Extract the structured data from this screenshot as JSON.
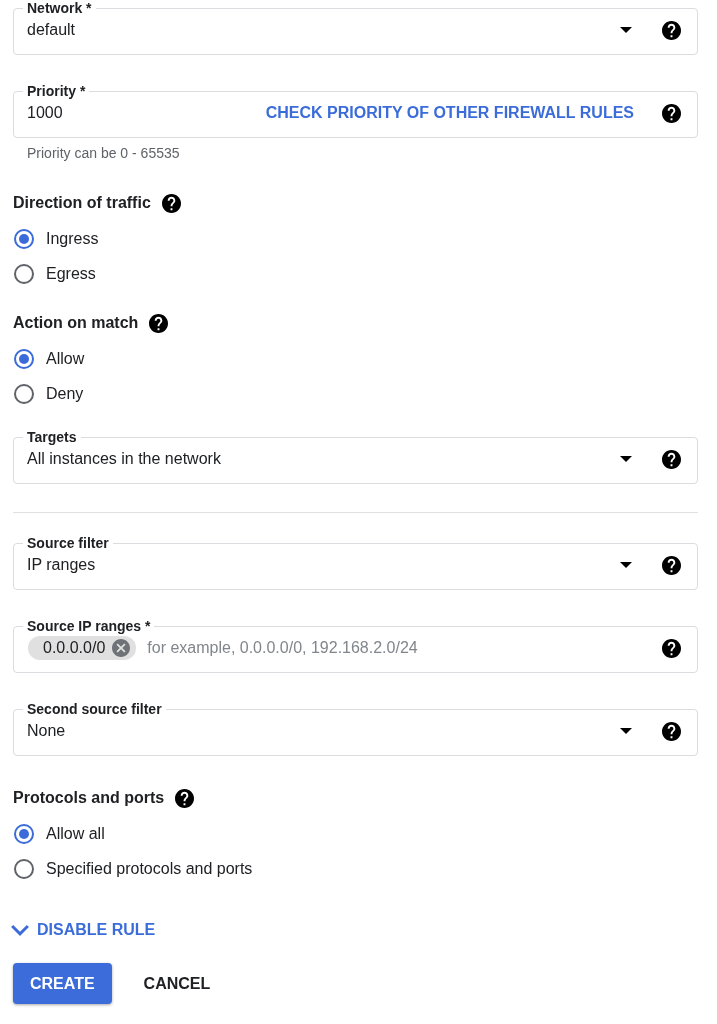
{
  "form": [
    {
      "kind": "select",
      "label": "Network *",
      "value": "default"
    },
    {
      "kind": "input",
      "label": "Priority *",
      "value": "1000",
      "link": "CHECK PRIORITY OF OTHER FIREWALL RULES",
      "hint": "Priority can be 0 - 65535"
    },
    {
      "kind": "radio_group",
      "label": "Direction of traffic",
      "options": [
        {
          "label": "Ingress",
          "selected": true
        },
        {
          "label": "Egress",
          "selected": false
        }
      ]
    },
    {
      "kind": "radio_group",
      "label": "Action on match",
      "options": [
        {
          "label": "Allow",
          "selected": true
        },
        {
          "label": "Deny",
          "selected": false
        }
      ]
    },
    {
      "kind": "select",
      "label": "Targets",
      "value": "All instances in the network"
    },
    {
      "kind": "divider"
    },
    {
      "kind": "select",
      "label": "Source filter",
      "value": "IP ranges"
    },
    {
      "kind": "chips",
      "label": "Source IP ranges *",
      "chips": [
        "0.0.0.0/0"
      ],
      "placeholder": "for example, 0.0.0.0/0, 192.168.2.0/24"
    },
    {
      "kind": "select",
      "label": "Second source filter",
      "value": "None"
    },
    {
      "kind": "radio_group",
      "label": "Protocols and ports",
      "options": [
        {
          "label": "Allow all",
          "selected": true
        },
        {
          "label": "Specified protocols and ports",
          "selected": false
        }
      ]
    }
  ],
  "toggle": {
    "label": "DISABLE RULE"
  },
  "buttons": [
    {
      "label": "CREATE",
      "kind": "primary"
    },
    {
      "label": "CANCEL",
      "kind": "text"
    }
  ]
}
